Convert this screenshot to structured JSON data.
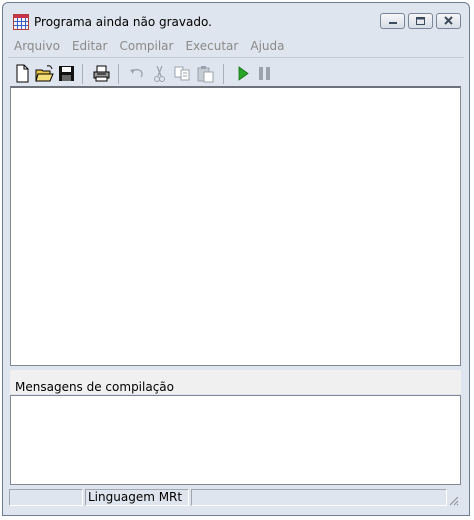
{
  "window": {
    "title": "Programa ainda não gravado."
  },
  "menu": [
    {
      "label": "Arquivo"
    },
    {
      "label": "Editar"
    },
    {
      "label": "Compilar"
    },
    {
      "label": "Executar"
    },
    {
      "label": "Ajuda"
    }
  ],
  "toolbar": {
    "buttons": [
      "new-file",
      "open-folder",
      "save",
      "print",
      "undo",
      "cut",
      "copy",
      "paste",
      "run",
      "pause"
    ]
  },
  "editor": {
    "content": ""
  },
  "messages": {
    "label": "Mensagens de compilação",
    "content": ""
  },
  "status": {
    "pane1": "",
    "language": "Linguagem MRt",
    "pane3": ""
  },
  "colors": {
    "window_bg": "#dfe5ee",
    "run_green": "#2aa52a",
    "disabled_gray": "#9aa3ad"
  }
}
